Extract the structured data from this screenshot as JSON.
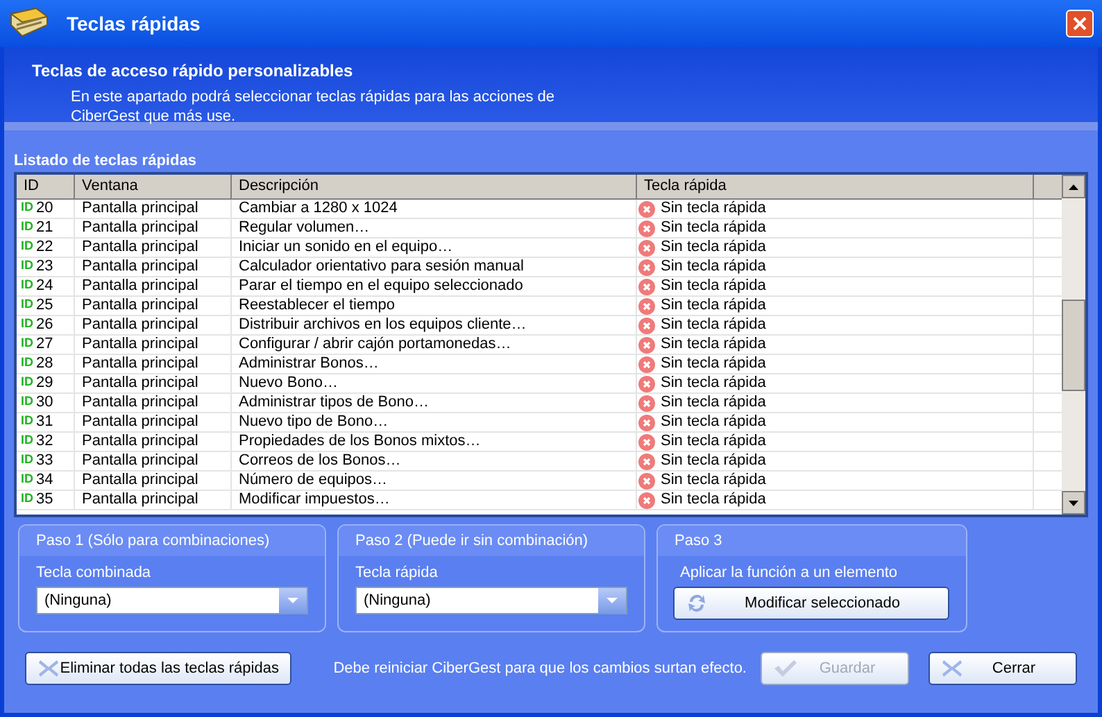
{
  "window": {
    "title": "Teclas rápidas"
  },
  "header": {
    "title": "Teclas de acceso rápido personalizables",
    "description": "En este apartado podrá seleccionar teclas rápidas para las acciones de CiberGest que más use."
  },
  "list": {
    "title": "Listado de teclas rápidas",
    "columns": [
      "ID",
      "Ventana",
      "Descripción",
      "Tecla rápida"
    ],
    "rows": [
      {
        "id_badge": "ID",
        "id": "20",
        "window": "Pantalla principal",
        "description": "Cambiar a 1280 x 1024",
        "hotkey": "Sin tecla rápida"
      },
      {
        "id_badge": "ID",
        "id": "21",
        "window": "Pantalla principal",
        "description": "Regular volumen…",
        "hotkey": "Sin tecla rápida"
      },
      {
        "id_badge": "ID",
        "id": "22",
        "window": "Pantalla principal",
        "description": "Iniciar un sonido en el equipo…",
        "hotkey": "Sin tecla rápida"
      },
      {
        "id_badge": "ID",
        "id": "23",
        "window": "Pantalla principal",
        "description": "Calculador orientativo para sesión manual",
        "hotkey": "Sin tecla rápida"
      },
      {
        "id_badge": "ID",
        "id": "24",
        "window": "Pantalla principal",
        "description": "Parar el tiempo en el equipo seleccionado",
        "hotkey": "Sin tecla rápida"
      },
      {
        "id_badge": "ID",
        "id": "25",
        "window": "Pantalla principal",
        "description": "Reestablecer el tiempo",
        "hotkey": "Sin tecla rápida"
      },
      {
        "id_badge": "ID",
        "id": "26",
        "window": "Pantalla principal",
        "description": "Distribuir archivos en los equipos cliente…",
        "hotkey": "Sin tecla rápida"
      },
      {
        "id_badge": "ID",
        "id": "27",
        "window": "Pantalla principal",
        "description": "Configurar / abrir cajón portamonedas…",
        "hotkey": "Sin tecla rápida"
      },
      {
        "id_badge": "ID",
        "id": "28",
        "window": "Pantalla principal",
        "description": "Administrar Bonos…",
        "hotkey": "Sin tecla rápida"
      },
      {
        "id_badge": "ID",
        "id": "29",
        "window": "Pantalla principal",
        "description": "Nuevo Bono…",
        "hotkey": "Sin tecla rápida"
      },
      {
        "id_badge": "ID",
        "id": "30",
        "window": "Pantalla principal",
        "description": "Administrar tipos de Bono…",
        "hotkey": "Sin tecla rápida"
      },
      {
        "id_badge": "ID",
        "id": "31",
        "window": "Pantalla principal",
        "description": "Nuevo tipo de Bono…",
        "hotkey": "Sin tecla rápida"
      },
      {
        "id_badge": "ID",
        "id": "32",
        "window": "Pantalla principal",
        "description": "Propiedades de los Bonos mixtos…",
        "hotkey": "Sin tecla rápida"
      },
      {
        "id_badge": "ID",
        "id": "33",
        "window": "Pantalla principal",
        "description": "Correos de los Bonos…",
        "hotkey": "Sin tecla rápida"
      },
      {
        "id_badge": "ID",
        "id": "34",
        "window": "Pantalla principal",
        "description": "Número de equipos…",
        "hotkey": "Sin tecla rápida"
      },
      {
        "id_badge": "ID",
        "id": "35",
        "window": "Pantalla principal",
        "description": "Modificar impuestos…",
        "hotkey": "Sin tecla rápida"
      }
    ]
  },
  "steps": [
    {
      "kind": "dropdown",
      "title": "Paso 1 (Sólo para combinaciones)",
      "label": "Tecla combinada",
      "value": "(Ninguna)"
    },
    {
      "kind": "dropdown",
      "title": "Paso 2 (Puede ir sin combinación)",
      "label": "Tecla rápida",
      "value": "(Ninguna)"
    },
    {
      "kind": "button",
      "title": "Paso 3",
      "label": "Aplicar la función a un elemento",
      "value": "Modificar seleccionado"
    }
  ],
  "footer": {
    "clear_button": "Eliminar todas las teclas rápidas",
    "notice": "Debe reiniciar CiberGest para que los cambios surtan efecto.",
    "buttons": [
      {
        "kind": "save",
        "label": "Guardar",
        "disabled": true
      },
      {
        "kind": "close",
        "label": "Cerrar",
        "disabled": false
      }
    ]
  }
}
